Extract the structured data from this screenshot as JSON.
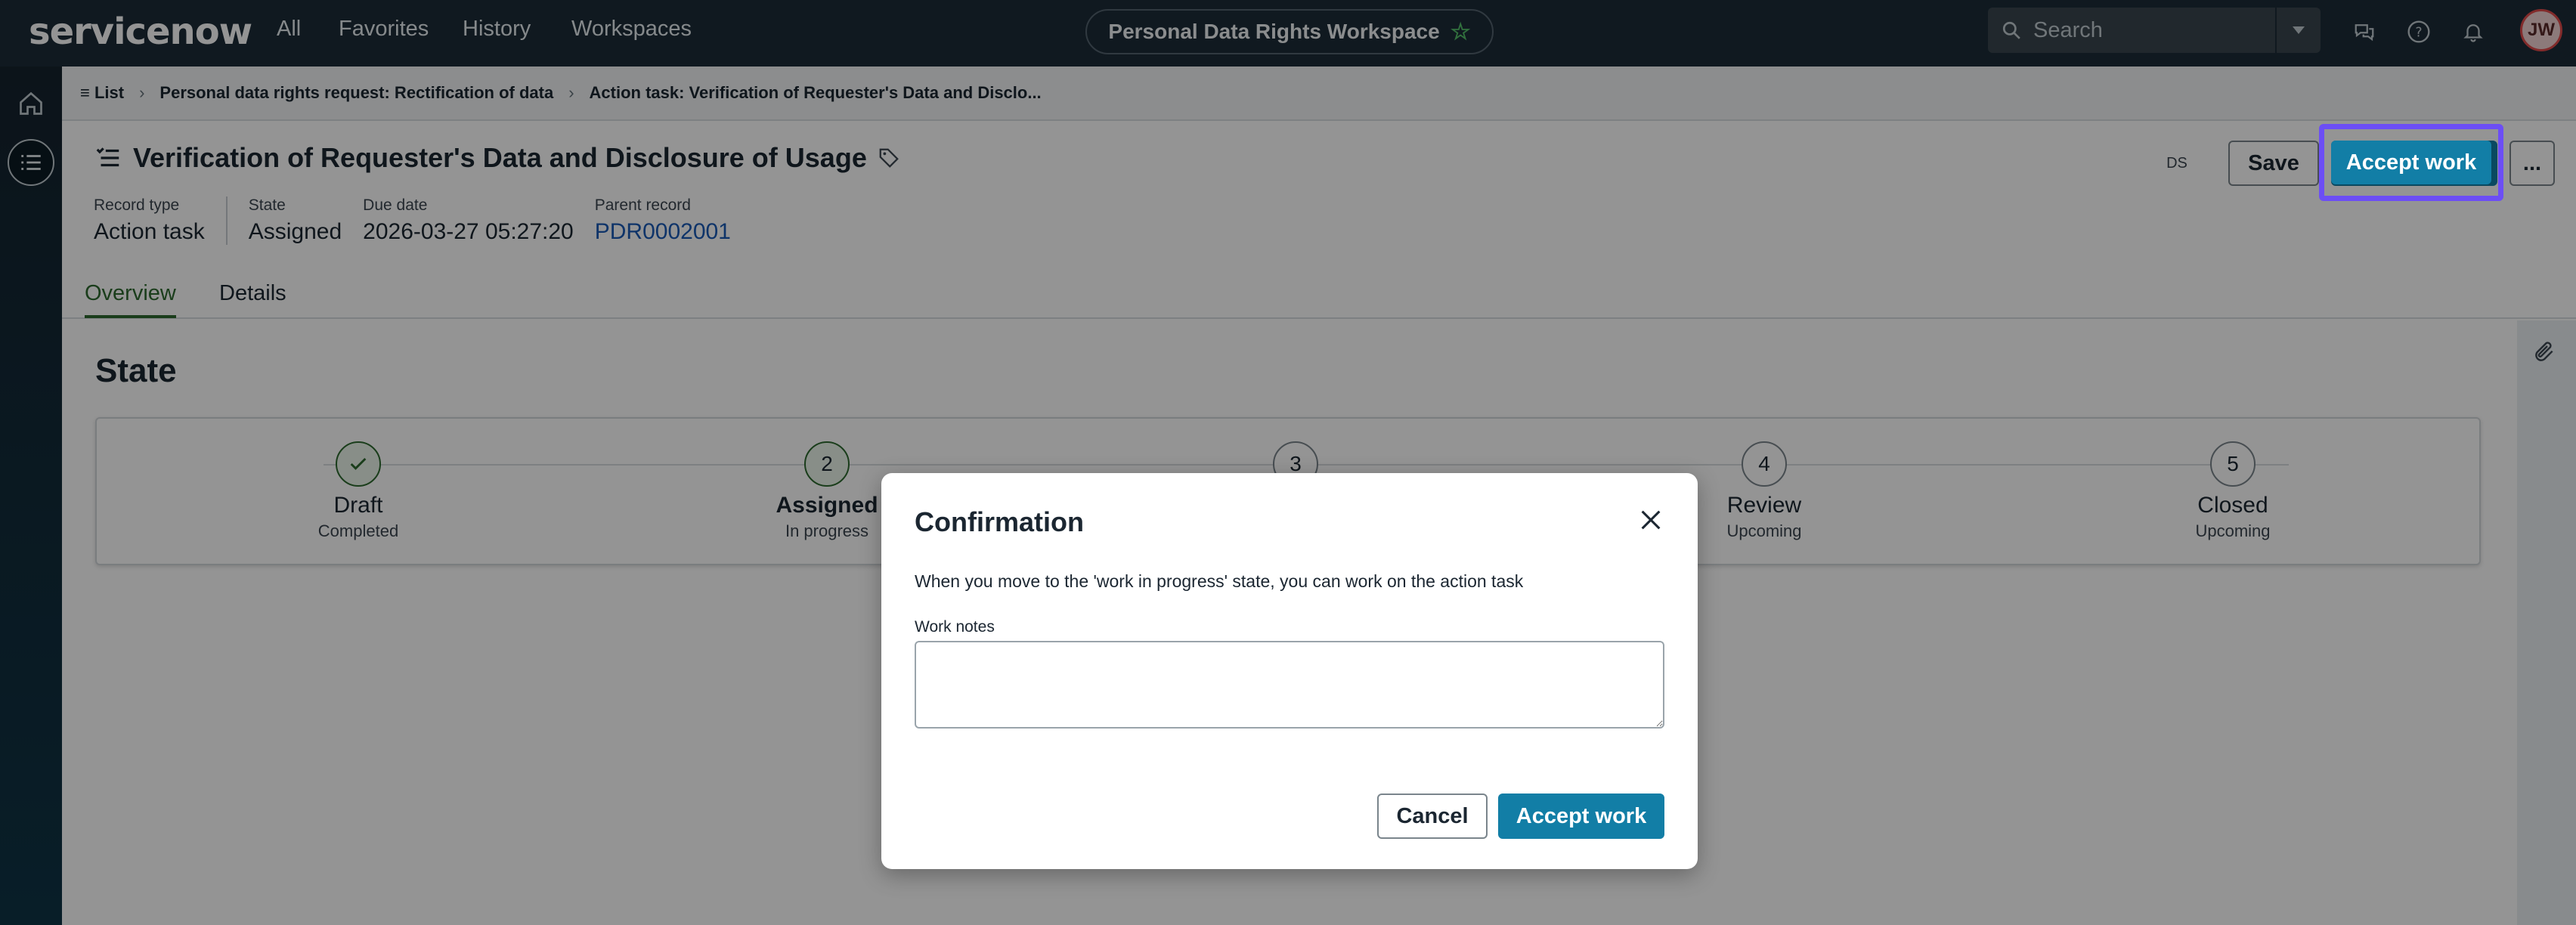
{
  "topnav": {
    "logo": "servicenow",
    "links": [
      "All",
      "Favorites",
      "History",
      "Workspaces"
    ],
    "workspace_title": "Personal Data Rights Workspace",
    "search_placeholder": "Search",
    "avatar_initials": "JW"
  },
  "breadcrumb": {
    "list_label": "List",
    "items": [
      "Personal data rights request: Rectification of data",
      "Action task: Verification of Requester's Data and Disclo..."
    ]
  },
  "record": {
    "title": "Verification of Requester's Data and Disclosure of Usage",
    "presence_initials": "DS",
    "fields": [
      {
        "label": "Record type",
        "value": "Action task"
      },
      {
        "label": "State",
        "value": "Assigned"
      },
      {
        "label": "Due date",
        "value": "2026-03-27 05:27:20"
      },
      {
        "label": "Parent record",
        "value": "PDR0002001"
      }
    ],
    "save_label": "Save",
    "accept_label": "Accept work",
    "more_label": "..."
  },
  "tabs": [
    "Overview",
    "Details"
  ],
  "state_section": {
    "heading": "State",
    "steps": [
      {
        "number": "",
        "name": "Draft",
        "status": "Completed"
      },
      {
        "number": "2",
        "name": "Assigned",
        "status": "In progress"
      },
      {
        "number": "3",
        "name": "",
        "status": ""
      },
      {
        "number": "4",
        "name": "Review",
        "status": "Upcoming"
      },
      {
        "number": "5",
        "name": "Closed",
        "status": "Upcoming"
      }
    ]
  },
  "modal": {
    "title": "Confirmation",
    "message": "When you move to the 'work in progress' state, you can work on the action task",
    "notes_label": "Work notes",
    "notes_value": "",
    "cancel_label": "Cancel",
    "accept_label": "Accept work"
  },
  "colors": {
    "nav_bg": "#1c2b38",
    "primary": "#127ea6",
    "highlight": "#6c4ef5",
    "active_tab": "#2d6a2f",
    "link": "#1a5bb6"
  }
}
